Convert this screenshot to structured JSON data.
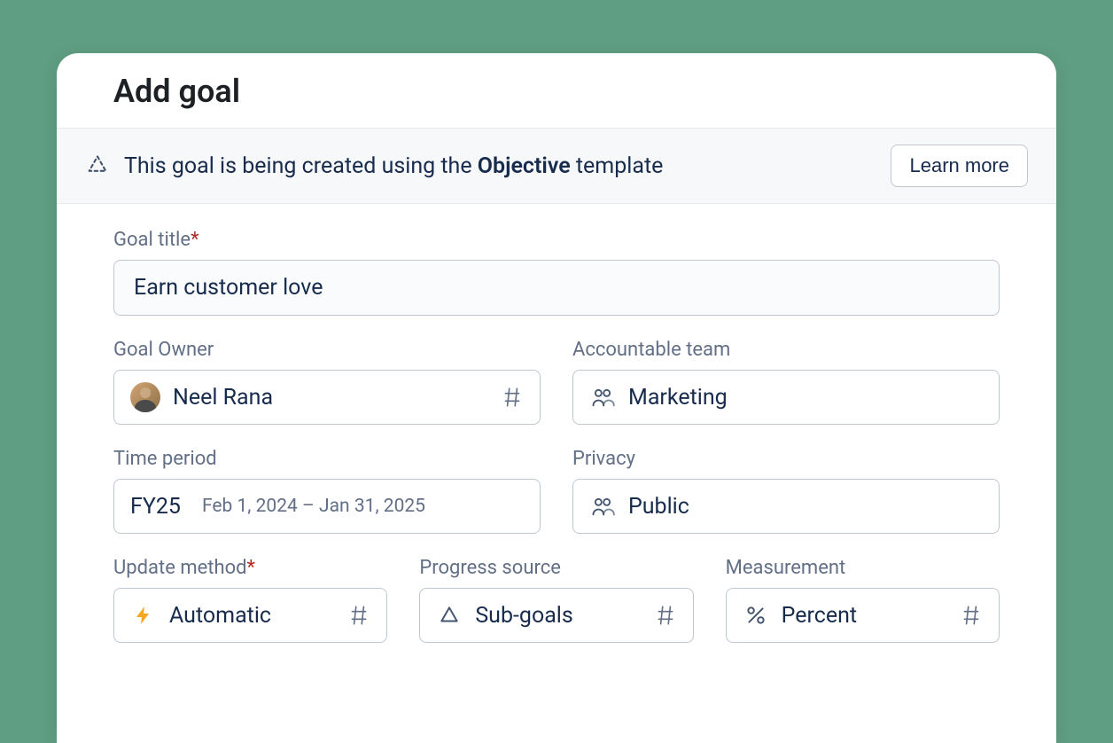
{
  "modal": {
    "title": "Add goal",
    "banner": {
      "text_prefix": "This goal is being created using the ",
      "text_bold": "Objective",
      "text_suffix": " template",
      "learn_more": "Learn more"
    },
    "fields": {
      "goal_title": {
        "label": "Goal title",
        "value": "Earn customer love"
      },
      "goal_owner": {
        "label": "Goal Owner",
        "value": "Neel Rana"
      },
      "accountable_team": {
        "label": "Accountable team",
        "value": "Marketing"
      },
      "time_period": {
        "label": "Time period",
        "value": "FY25",
        "sub_value": "Feb 1, 2024 – Jan 31, 2025"
      },
      "privacy": {
        "label": "Privacy",
        "value": "Public"
      },
      "update_method": {
        "label": "Update method",
        "value": "Automatic"
      },
      "progress_source": {
        "label": "Progress source",
        "value": "Sub-goals"
      },
      "measurement": {
        "label": "Measurement",
        "value": "Percent"
      }
    }
  }
}
